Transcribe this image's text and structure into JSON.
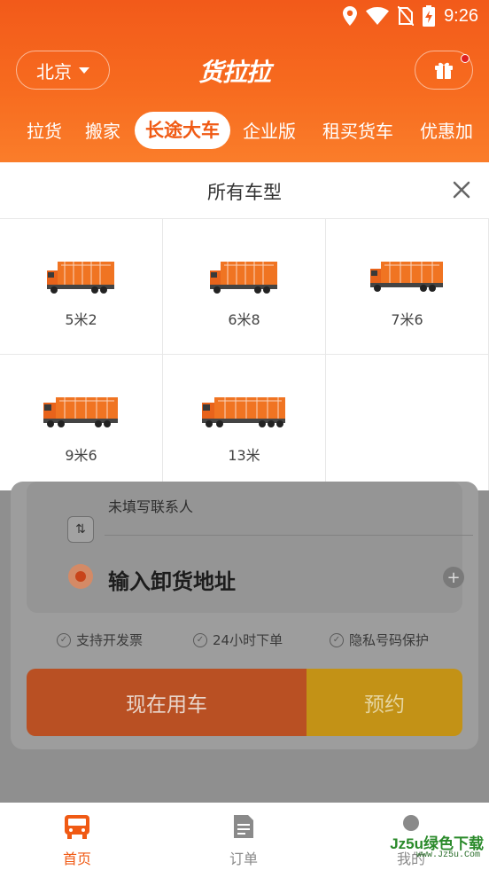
{
  "status_bar": {
    "time": "9:26",
    "icons": [
      "location-icon",
      "wifi-icon",
      "no-sim-icon",
      "battery-charging-icon"
    ]
  },
  "header": {
    "city": "北京",
    "logo": "货拉拉",
    "tabs": [
      "拉货",
      "搬家",
      "长途大车",
      "企业版",
      "租买货车",
      "优惠加"
    ],
    "active_tab": "长途大车"
  },
  "sheet": {
    "title": "所有车型",
    "vehicles": [
      {
        "label": "5米2"
      },
      {
        "label": "6米8"
      },
      {
        "label": "7米6"
      },
      {
        "label": "9米6"
      },
      {
        "label": "13米"
      }
    ]
  },
  "order_form": {
    "contact_placeholder": "未填写联系人",
    "destination_placeholder": "输入卸货地址",
    "features": [
      "支持开发票",
      "24小时下单",
      "隐私号码保护"
    ],
    "use_now_label": "现在用车",
    "book_label": "预约"
  },
  "bottom_nav": {
    "items": [
      {
        "label": "首页",
        "icon": "bus-icon",
        "active": true
      },
      {
        "label": "订单",
        "icon": "document-icon",
        "active": false
      },
      {
        "label": "我的",
        "icon": "profile-icon",
        "active": false
      }
    ]
  },
  "watermark": {
    "main": "Jz5u绿色下载",
    "sub": "www.Jz5u.Com"
  },
  "colors": {
    "brand": "#f25a1a",
    "book": "#c39216",
    "sheet_bg": "#ffffff"
  }
}
